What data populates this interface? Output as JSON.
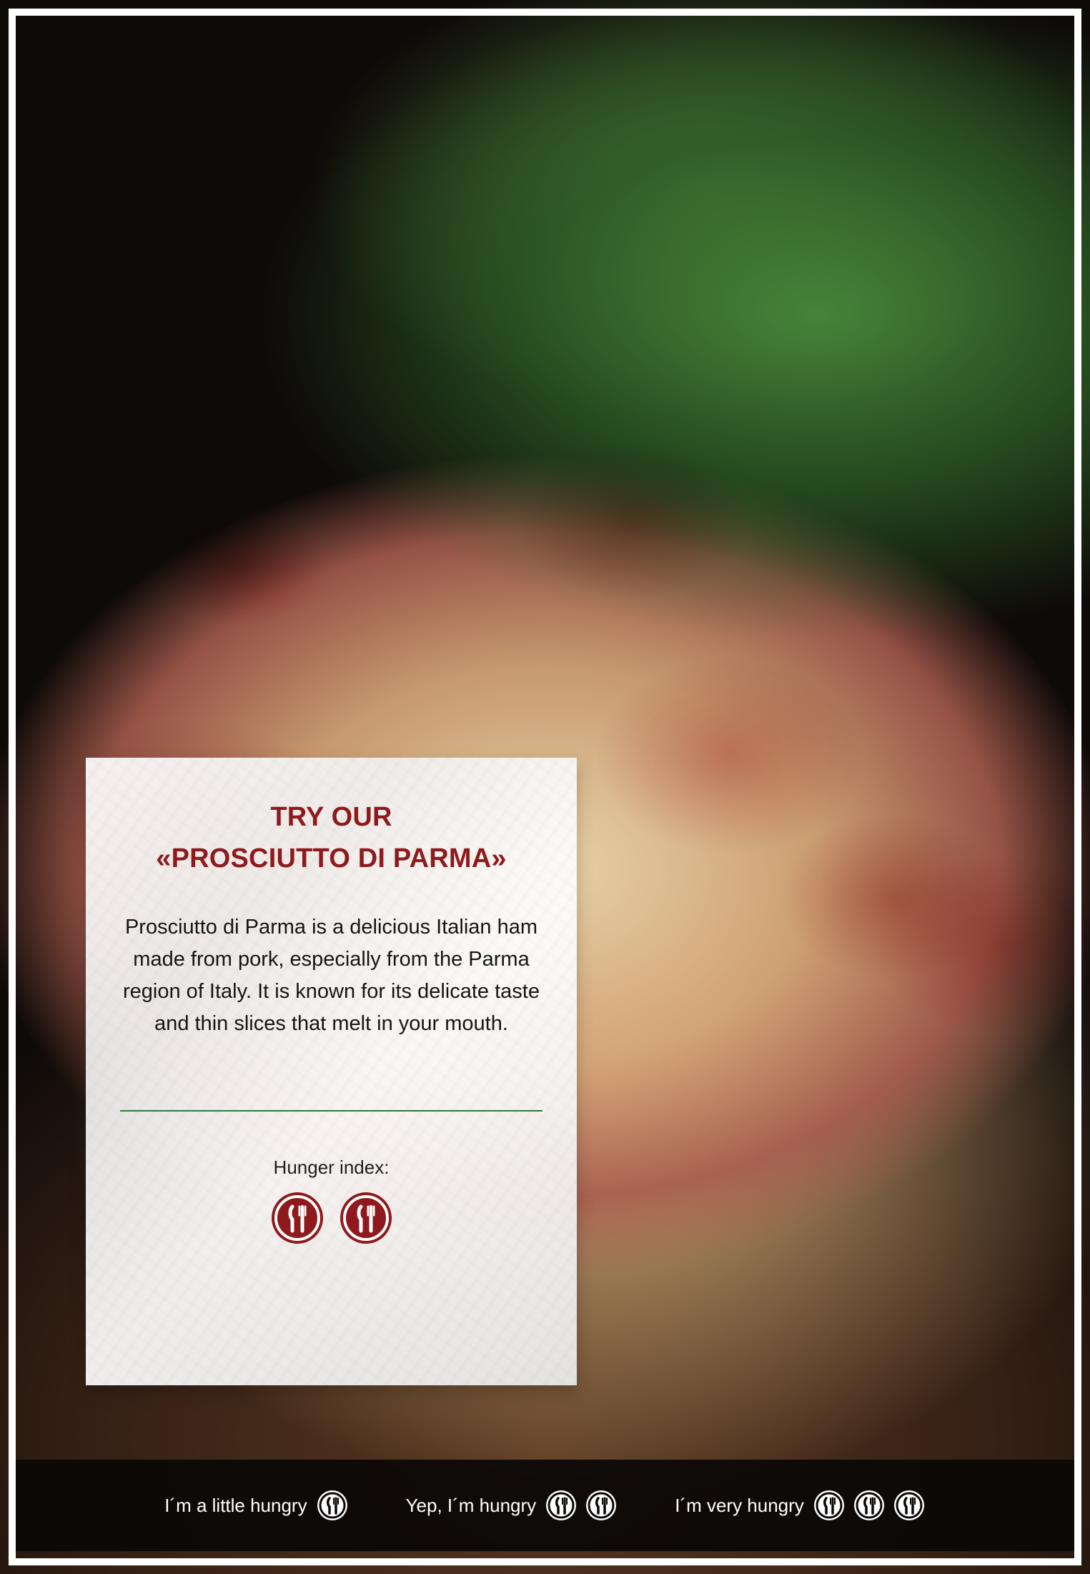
{
  "colors": {
    "accent_red": "#8f1a1d",
    "divider_green": "#2a7a41",
    "footer_bg": "#0a0807",
    "white": "#ffffff"
  },
  "card": {
    "title": "TRY OUR\n«PROSCIUTTO DI PARMA»",
    "description": "Prosciutto di Parma is a delicious Italian ham made from pork, especially from the Parma region of Italy. It is known for its delicate taste and thin slices that melt in your mouth.",
    "hunger_label": "Hunger index:",
    "hunger_level": 2,
    "hunger_icon": "fork-knife-icon"
  },
  "footer": {
    "legend": [
      {
        "label": "I´m a little hungry",
        "level": 1,
        "icon": "fork-knife-icon"
      },
      {
        "label": "Yep, I´m hungry",
        "level": 2,
        "icon": "fork-knife-icon"
      },
      {
        "label": "I´m very hungry",
        "level": 3,
        "icon": "fork-knife-icon"
      }
    ]
  }
}
